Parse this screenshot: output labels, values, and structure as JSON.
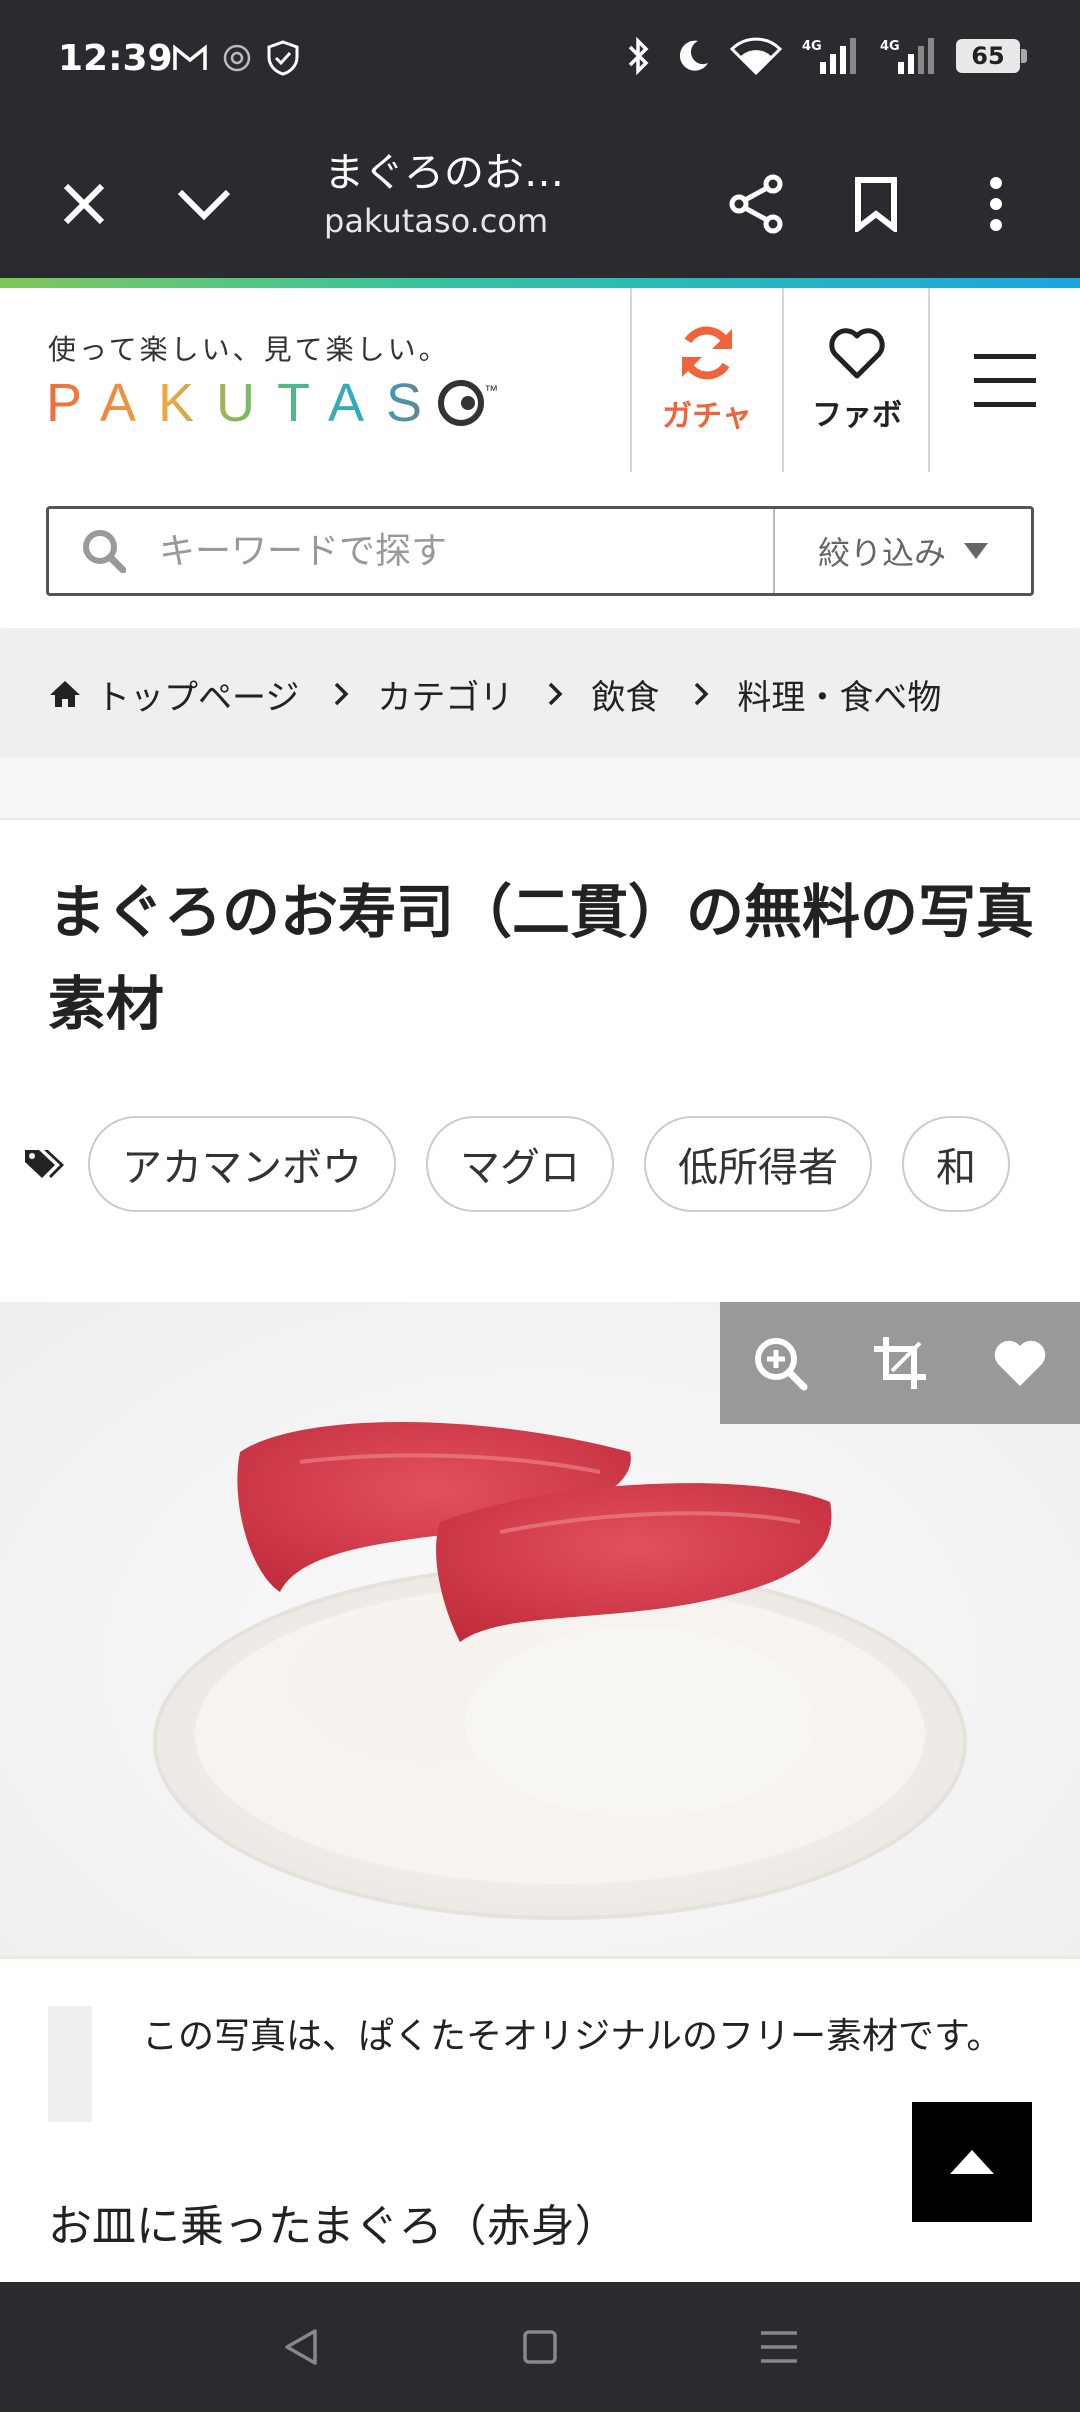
{
  "status_bar": {
    "time": "12:39",
    "left_icons": [
      "gmail-icon",
      "at-sign-icon",
      "shield-check-icon"
    ],
    "right_icons": [
      "bluetooth-icon",
      "moon-icon",
      "wifi-icon",
      "signal-4g-icon",
      "signal-4g-icon"
    ],
    "battery": "65"
  },
  "browser": {
    "title": "まぐろのお…",
    "url": "pakutaso.com",
    "buttons": [
      "close-icon",
      "chevron-down-icon",
      "share-icon",
      "bookmark-icon",
      "more-vert-icon"
    ]
  },
  "site": {
    "tagline": "使って楽しい、見て楽しい。",
    "logo": "PAKUTAS",
    "gacha_label": "ガチャ",
    "fav_label": "ファボ",
    "search": {
      "placeholder": "キーワードで探す",
      "filter_label": "絞り込み"
    },
    "colors": {
      "accent": "#f0643c",
      "text": "#222222"
    }
  },
  "breadcrumb": [
    "トップページ",
    "カテゴリ",
    "飲食",
    "料理・食べ物"
  ],
  "page": {
    "title": "まぐろのお寿司（二貫）の無料の写真素材",
    "tags": [
      "アカマンボウ",
      "マグロ",
      "低所得者",
      "和"
    ],
    "note": "この写真は、ぱくたそオリジナルのフリー素材です。",
    "caption": "お皿に乗ったまぐろ（赤身）"
  }
}
